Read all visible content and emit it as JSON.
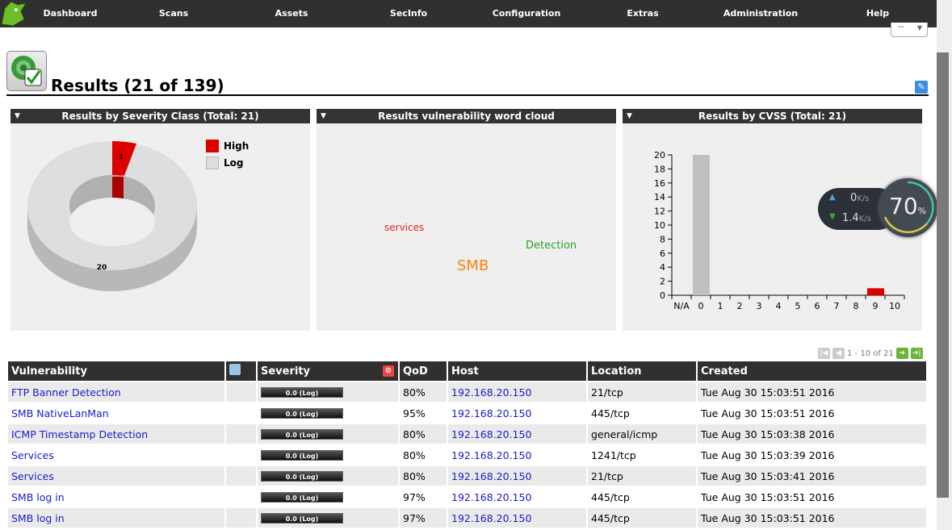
{
  "nav": {
    "items": [
      "Dashboard",
      "Scans",
      "Assets",
      "SecInfo",
      "Configuration",
      "Extras",
      "Administration",
      "Help"
    ]
  },
  "filter_select": {
    "value": "--"
  },
  "page": {
    "title": "Results (21 of 139)"
  },
  "panels": {
    "severity": {
      "title": "Results by Severity Class (Total: 21)"
    },
    "wordcloud": {
      "title": "Results vulnerability word cloud",
      "words": [
        {
          "text": "services",
          "color": "#d62728"
        },
        {
          "text": "Detection",
          "color": "#2ca02c"
        },
        {
          "text": "SMB",
          "color": "#ff7f0e"
        }
      ]
    },
    "cvss": {
      "title": "Results by CVSS (Total: 21)"
    }
  },
  "chart_data": [
    {
      "type": "pie",
      "style": "3d-donut",
      "slices": [
        {
          "label": "High",
          "value": 1,
          "color": "#dd0000"
        },
        {
          "label": "Log",
          "value": 20,
          "color": "#dddddd"
        }
      ],
      "legend": "top-right"
    },
    {
      "type": "bar",
      "categories": [
        "N/A",
        "0",
        "1",
        "2",
        "3",
        "4",
        "5",
        "6",
        "7",
        "8",
        "9",
        "10"
      ],
      "values": [
        0,
        20,
        0,
        0,
        0,
        0,
        0,
        0,
        0,
        0,
        1,
        0
      ],
      "colors": {
        "0": "#c0c0c0",
        "9": "#dd0000"
      },
      "ylim": [
        0,
        20
      ],
      "yticks": [
        0,
        2,
        4,
        6,
        8,
        10,
        12,
        14,
        16,
        18,
        20
      ]
    }
  ],
  "pager": {
    "text": "1 - 10 of 21"
  },
  "table": {
    "headers": [
      "Vulnerability",
      "",
      "Severity",
      "QoD",
      "Host",
      "Location",
      "Created"
    ],
    "rows": [
      {
        "vuln": "FTP Banner Detection",
        "severity": "0.0 (Log)",
        "qod": "80%",
        "host": "192.168.20.150",
        "location": "21/tcp",
        "created": "Tue Aug 30 15:03:51 2016"
      },
      {
        "vuln": "SMB NativeLanMan",
        "severity": "0.0 (Log)",
        "qod": "95%",
        "host": "192.168.20.150",
        "location": "445/tcp",
        "created": "Tue Aug 30 15:03:51 2016"
      },
      {
        "vuln": "ICMP Timestamp Detection",
        "severity": "0.0 (Log)",
        "qod": "80%",
        "host": "192.168.20.150",
        "location": "general/icmp",
        "created": "Tue Aug 30 15:03:38 2016"
      },
      {
        "vuln": "Services",
        "severity": "0.0 (Log)",
        "qod": "80%",
        "host": "192.168.20.150",
        "location": "1241/tcp",
        "created": "Tue Aug 30 15:03:39 2016"
      },
      {
        "vuln": "Services",
        "severity": "0.0 (Log)",
        "qod": "80%",
        "host": "192.168.20.150",
        "location": "21/tcp",
        "created": "Tue Aug 30 15:03:41 2016"
      },
      {
        "vuln": "SMB log in",
        "severity": "0.0 (Log)",
        "qod": "97%",
        "host": "192.168.20.150",
        "location": "445/tcp",
        "created": "Tue Aug 30 15:03:51 2016"
      },
      {
        "vuln": "SMB log in",
        "severity": "0.0 (Log)",
        "qod": "97%",
        "host": "192.168.20.150",
        "location": "445/tcp",
        "created": "Tue Aug 30 15:03:51 2016"
      }
    ]
  },
  "net_widget": {
    "up": "0",
    "down": "1.4",
    "unit": "K/s",
    "percent": "70",
    "percent_unit": "%"
  }
}
